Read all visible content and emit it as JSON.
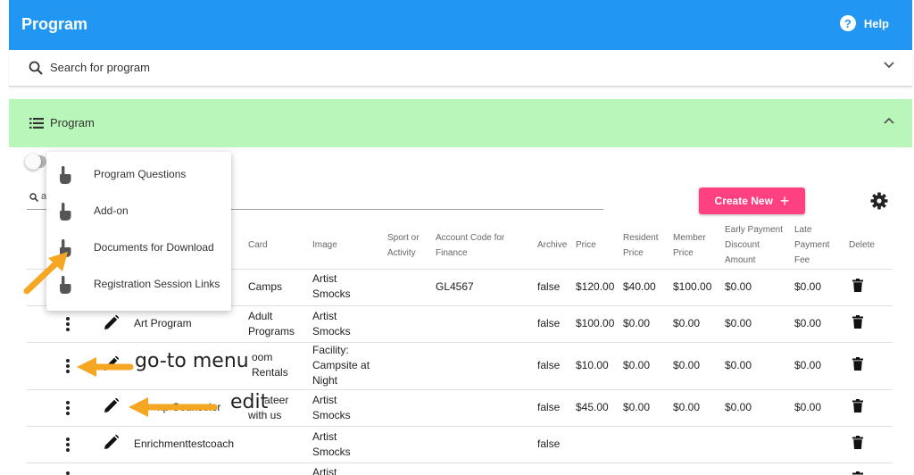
{
  "header": {
    "title": "Program",
    "help_label": "Help",
    "help_glyph": "?"
  },
  "search": {
    "label": "Search for program"
  },
  "section": {
    "label": "Program"
  },
  "filter": {
    "partial_text": "a"
  },
  "toolbar": {
    "create_label": "Create New",
    "create_glyph": "+"
  },
  "table": {
    "columns": {
      "card": "Card",
      "image": "Image",
      "sport1": "Sport or",
      "sport2": "Activity",
      "account1": "Account Code for",
      "account2": "Finance",
      "archive": "Archive",
      "price": "Price",
      "resident1": "Resident",
      "resident2": "Price",
      "member1": "Member",
      "member2": "Price",
      "early1": "Early Payment",
      "early2": "Discount",
      "early3": "Amount",
      "late1": "Late",
      "late2": "Payment",
      "late3": "Fee",
      "delete": "Delete"
    },
    "rows": [
      {
        "card": "Camps",
        "image1": "Artist",
        "image2": "Smocks",
        "account": "GL4567",
        "archive": "false",
        "price": "$120.00",
        "resident": "$40.00",
        "member": "$100.00",
        "early": "$0.00",
        "late": "$0.00"
      },
      {
        "name": "Art Program",
        "card1": "Adult",
        "card2": "Programs",
        "image1": "Artist",
        "image2": "Smocks",
        "archive": "false",
        "price": "$100.00",
        "resident": "$0.00",
        "member": "$0.00",
        "early": "$0.00",
        "late": "$0.00"
      },
      {
        "card1": "oom",
        "card2": "Rentals",
        "image1": "Facility:",
        "image2": "Campsite at",
        "image3": "Night",
        "archive": "false",
        "price": "$10.00",
        "resident": "$0.00",
        "member": "$0.00",
        "early": "$0.00",
        "late": "$0.00"
      },
      {
        "name_partial": "np Counselor",
        "card1": "ateer",
        "card2": "with us",
        "image1": "Artist",
        "image2": "Smocks",
        "archive": "false",
        "price": "$45.00",
        "resident": "$0.00",
        "member": "$0.00",
        "early": "$0.00",
        "late": "$0.00"
      },
      {
        "name": "Enrichmenttestcoach",
        "image1": "Artist",
        "image2": "Smocks",
        "archive": "false"
      },
      {
        "image1": "Artist"
      }
    ]
  },
  "menu": {
    "items": [
      {
        "label": "Program Questions"
      },
      {
        "label": "Add-on"
      },
      {
        "label": "Documents for Download"
      },
      {
        "label": "Registration Session Links"
      }
    ]
  },
  "annotations": {
    "goto_menu": "go-to menu",
    "edit": "edit",
    "arrow_color": "#f5a623"
  },
  "colors": {
    "header": "#2196f3",
    "section": "#b9f6b9",
    "create": "#ff4081"
  },
  "icons": [
    "search-icon",
    "chevron-down-icon",
    "list-icon",
    "chevron-up-icon",
    "help-icon",
    "settings-gear-icon",
    "kebab-menu-icon",
    "pencil-icon",
    "trash-icon",
    "touch-hand-icon"
  ]
}
